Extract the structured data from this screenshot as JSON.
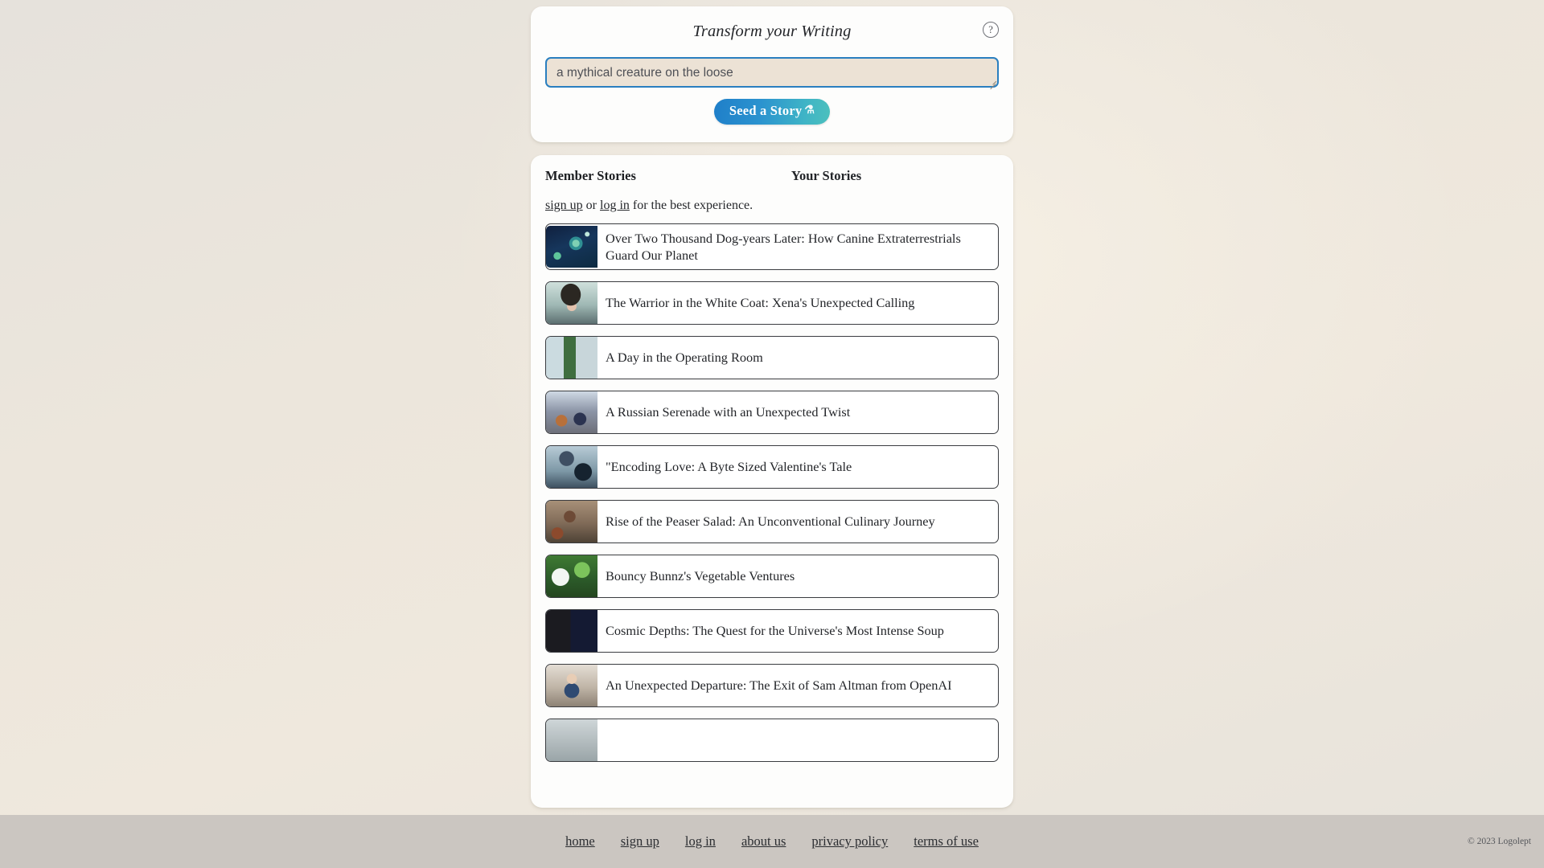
{
  "composer": {
    "title": "Transform your Writing",
    "help_icon_label": "?",
    "prompt_value": "a mythical creature on the loose",
    "prompt_placeholder": "a mythical creature on the loose",
    "submit_label": "Seed a Story",
    "submit_icon": "flask-icon",
    "submit_icon_glyph": "⚗",
    "accent_color": "#2a7fc0",
    "button_gradient_from": "#1f7fc9",
    "button_gradient_to": "#4cc0bd",
    "input_background": "#ece2d5"
  },
  "stories_panel": {
    "tabs": [
      {
        "label": "Member Stories",
        "active": true
      },
      {
        "label": "Your Stories",
        "active": false
      }
    ],
    "notice": {
      "signup_label": "sign up",
      "separator": " or ",
      "login_label": "log in",
      "suffix": " for the best experience."
    },
    "items": [
      {
        "title": "Over Two Thousand Dog-years Later: How Canine Extraterrestrials Guard Our Planet",
        "thumb": "space-planet-thumb"
      },
      {
        "title": "The Warrior in the White Coat: Xena's Unexpected Calling",
        "thumb": "warrior-surgeon-thumb"
      },
      {
        "title": "A Day in the Operating Room",
        "thumb": "operating-room-thumb"
      },
      {
        "title": "A Russian Serenade with an Unexpected Twist",
        "thumb": "crowd-ballroom-thumb"
      },
      {
        "title": "\"Encoding Love: A Byte Sized Valentine's Tale",
        "thumb": "programmer-desk-thumb"
      },
      {
        "title": "Rise of the Peaser Salad: An Unconventional Culinary Journey",
        "thumb": "chef-kitchen-thumb"
      },
      {
        "title": "Bouncy Bunnz's Vegetable Ventures",
        "thumb": "rabbit-garden-thumb"
      },
      {
        "title": "Cosmic Depths: The Quest for the Universe's Most Intense Soup",
        "thumb": "cosmic-collage-thumb"
      },
      {
        "title": "An Unexpected Departure: The Exit of Sam Altman from OpenAI",
        "thumb": "boardroom-thumb"
      }
    ]
  },
  "footer": {
    "links": [
      {
        "label": "home"
      },
      {
        "label": "sign up"
      },
      {
        "label": "log in"
      },
      {
        "label": "about us"
      },
      {
        "label": "privacy policy"
      },
      {
        "label": "terms of use"
      }
    ],
    "copyright": "© 2023 Logolept"
  }
}
